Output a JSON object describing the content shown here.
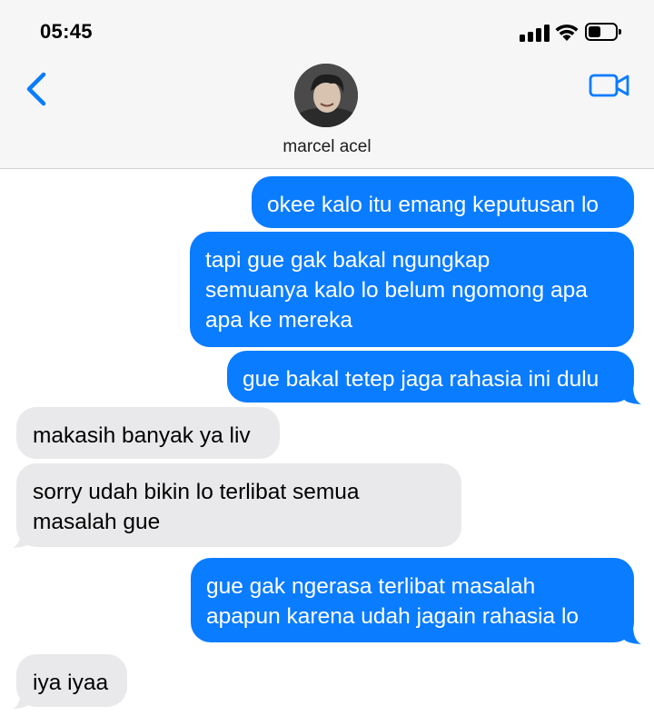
{
  "status_bar": {
    "time": "05:45",
    "battery_level": 0.45
  },
  "header": {
    "contact_name": "marcel acel",
    "back_icon": "chevron-left-icon",
    "video_icon": "video-camera-icon",
    "accent_color": "#0a7cff"
  },
  "messages": [
    {
      "direction": "sent",
      "text": "okee kalo itu emang keputusan lo"
    },
    {
      "direction": "sent",
      "text": "tapi gue gak bakal ngungkap\nsemuanya kalo lo belum ngomong apa\napa ke mereka"
    },
    {
      "direction": "sent",
      "text": "gue bakal tetep jaga rahasia ini dulu"
    },
    {
      "direction": "received",
      "text": "makasih banyak ya liv"
    },
    {
      "direction": "received",
      "text": "sorry udah bikin lo terlibat semua\nmasalah gue"
    },
    {
      "direction": "sent",
      "text": "gue gak ngerasa terlibat masalah\napapun karena udah jagain rahasia lo"
    },
    {
      "direction": "received",
      "text": "iya iyaa"
    }
  ],
  "colors": {
    "sent_bubble": "#0a7cff",
    "received_bubble": "#e9e9eb",
    "header_bg": "#f6f6f6"
  }
}
